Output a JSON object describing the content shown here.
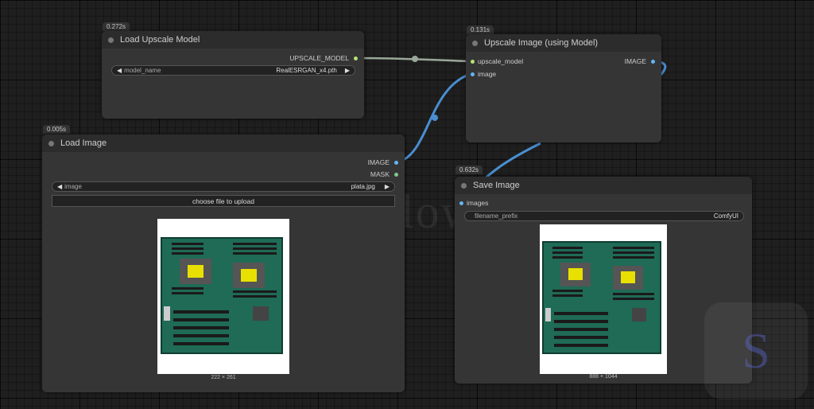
{
  "nodes": {
    "load_upscale_model": {
      "timing": "0.272s",
      "title": "Load Upscale Model",
      "output": "UPSCALE_MODEL",
      "widget_label": "model_name",
      "widget_value": "RealESRGAN_x4.pth"
    },
    "upscale_image": {
      "timing": "0.131s",
      "title": "Upscale Image (using Model)",
      "input_model": "upscale_model",
      "input_image": "image",
      "output": "IMAGE"
    },
    "load_image": {
      "timing": "0.005s",
      "title": "Load Image",
      "output_image": "IMAGE",
      "output_mask": "MASK",
      "widget_label": "image",
      "widget_value": "plata.jpg",
      "upload_button": "choose file to upload",
      "preview_size": "222 × 261"
    },
    "save_image": {
      "timing": "0.632s",
      "title": "Save Image",
      "input_images": "images",
      "widget_label": "filename_prefix",
      "widget_value": "ComfyUI",
      "preview_size": "888 × 1044"
    }
  },
  "watermark": "ServerFlow",
  "logo_letter": "S",
  "icons": {
    "arrow_left": "◀",
    "arrow_right": "▶"
  },
  "colors": {
    "upscale_model_socket": "#b3e573",
    "image_socket": "#64b5f6",
    "mask_socket": "#81c784"
  }
}
